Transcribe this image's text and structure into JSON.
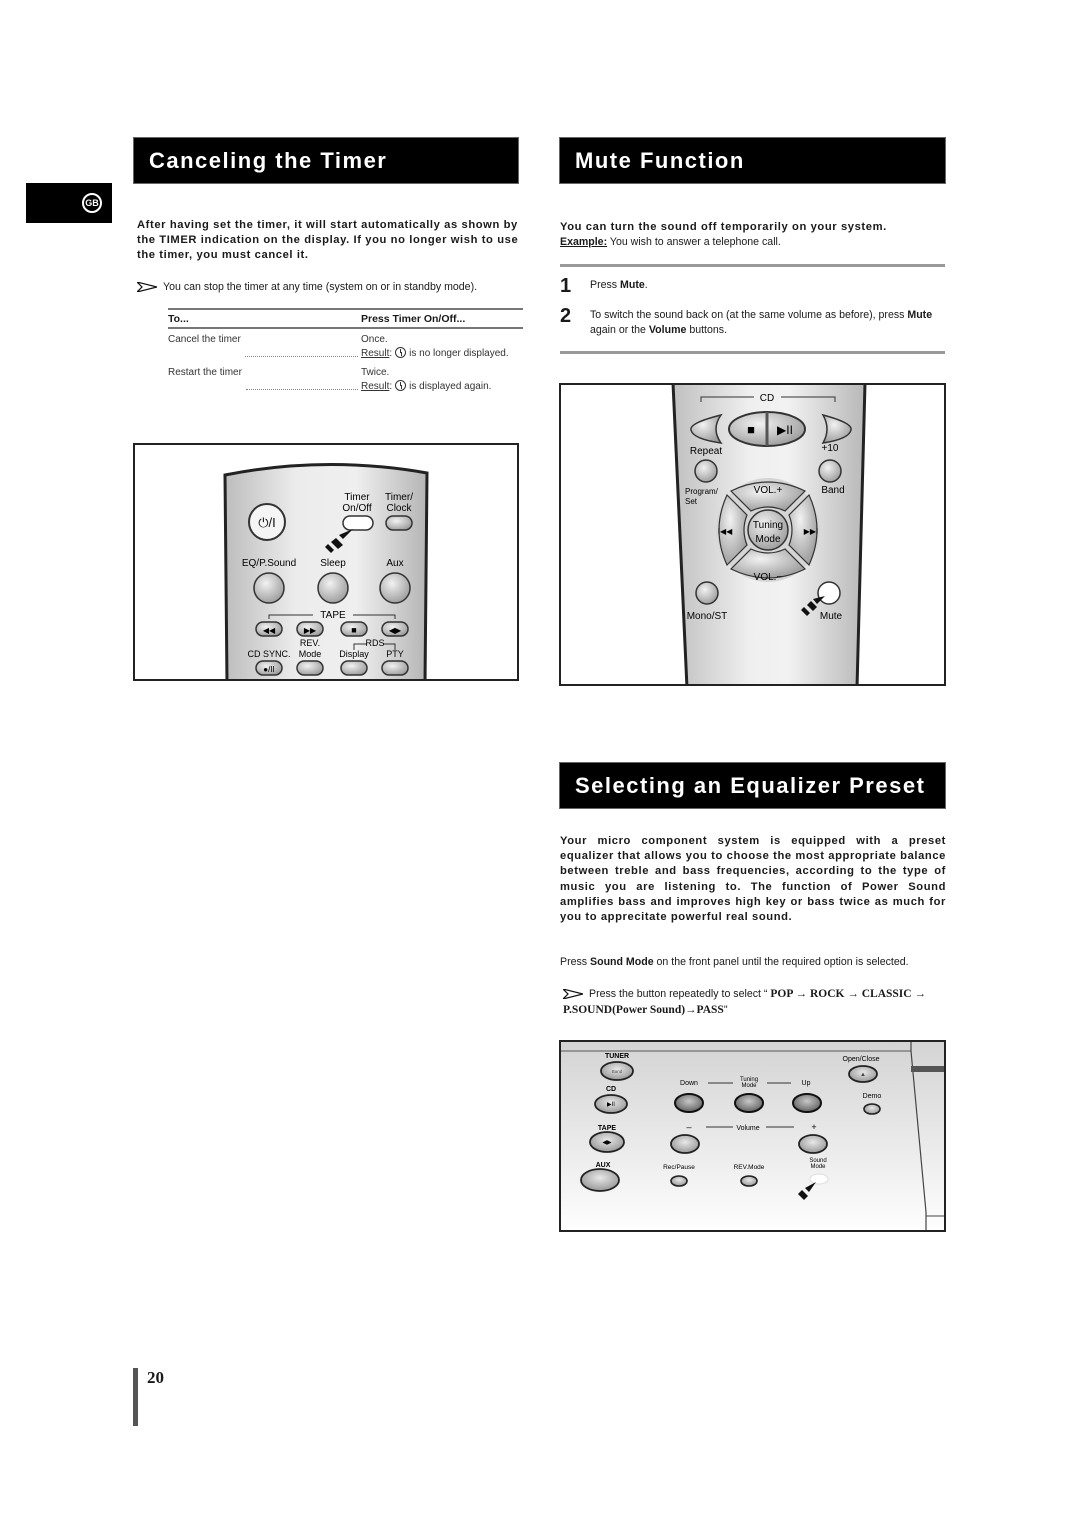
{
  "language_badge": "GB",
  "page_number": "20",
  "canceling_timer": {
    "title": "Canceling the Timer",
    "intro": "After having set the timer, it will start automatically as shown by the TIMER indication on the display. If you no longer wish to use the timer, you must cancel it.",
    "note": "You can stop the timer at any time (system on or in standby mode).",
    "table": {
      "col_to": "To...",
      "col_press": "Press Timer On/Off...",
      "rows": [
        {
          "action": "Cancel the timer",
          "press": "Once.",
          "result_label": "Result",
          "result_text": "is no longer displayed."
        },
        {
          "action": "Restart the timer",
          "press": "Twice.",
          "result_label": "Result",
          "result_text": "is displayed again."
        }
      ]
    },
    "remote": {
      "power": "⏻/I",
      "timer_onoff": [
        "Timer",
        "On/Off"
      ],
      "timer_clock": [
        "Timer/",
        "Clock"
      ],
      "eq": "EQ/P.Sound",
      "sleep": "Sleep",
      "aux": "Aux",
      "tape": "TAPE",
      "rew": "◀◀",
      "ff": "▶▶",
      "stop": "■",
      "dir": "◀▶",
      "cd_sync": "CD SYNC.",
      "rev_mode": [
        "REV.",
        "Mode"
      ],
      "rds": "RDS",
      "display": "Display",
      "pty": "PTY",
      "rec_pause": "●/II"
    }
  },
  "mute": {
    "title": "Mute Function",
    "intro": "You can turn the sound off temporarily on your system.",
    "example_label": "Example:",
    "example_text": " You wish to answer a telephone call.",
    "steps": [
      {
        "num": "1",
        "pre": "Press ",
        "bold": "Mute",
        "post": "."
      },
      {
        "num": "2",
        "pre": "To switch the sound back on (at the same volume as before), press ",
        "bold": "Mute",
        "mid": " again or the ",
        "bold2": "Volume",
        "post": " buttons."
      }
    ],
    "remote": {
      "cd": "CD",
      "stop": "■",
      "play_pause": "▶II",
      "repeat": "Repeat",
      "plus10": "+10",
      "program_set": [
        "Program/",
        "Set"
      ],
      "band": "Band",
      "vol_up": "VOL.+",
      "vol_down": "VOL.−",
      "prev": "I◀◀",
      "next": "▶▶I",
      "tuning_mode": [
        "Tuning",
        "Mode"
      ],
      "mono_st": "Mono/ST",
      "mute": "Mute"
    }
  },
  "equalizer": {
    "title": "Selecting an Equalizer Preset",
    "intro": "Your micro component system is equipped with a preset equalizer that allows you to choose the most appropriate balance between treble and bass frequencies, according to the type of music you are listening to. The function of Power Sound amplifies bass and improves high key or bass twice as much for you to apprecitate powerful real sound.",
    "instruction_pre": "Press ",
    "instruction_bold": "Sound Mode",
    "instruction_post": " on the front panel until the required option is selected.",
    "note_pre": "Press the button repeatedly to select “ ",
    "note_sequence": "POP → ROCK → CLASSIC → P.SOUND(Power Sound)→PASS",
    "note_post": "\"",
    "panel": {
      "tuner": "TUNER",
      "band": "Band",
      "cd": "CD",
      "tape": "TAPE",
      "aux": "AUX",
      "down": "Down",
      "tuning_mode": [
        "Tuning",
        "Mode"
      ],
      "up": "Up",
      "minus": "–",
      "volume": "Volume",
      "plus": "+",
      "rec_pause": "Rec/Pause",
      "rev_mode": "REV.Mode",
      "sound_mode": [
        "Sound",
        "Mode"
      ],
      "open_close": "Open/Close",
      "demo": "Demo"
    }
  }
}
